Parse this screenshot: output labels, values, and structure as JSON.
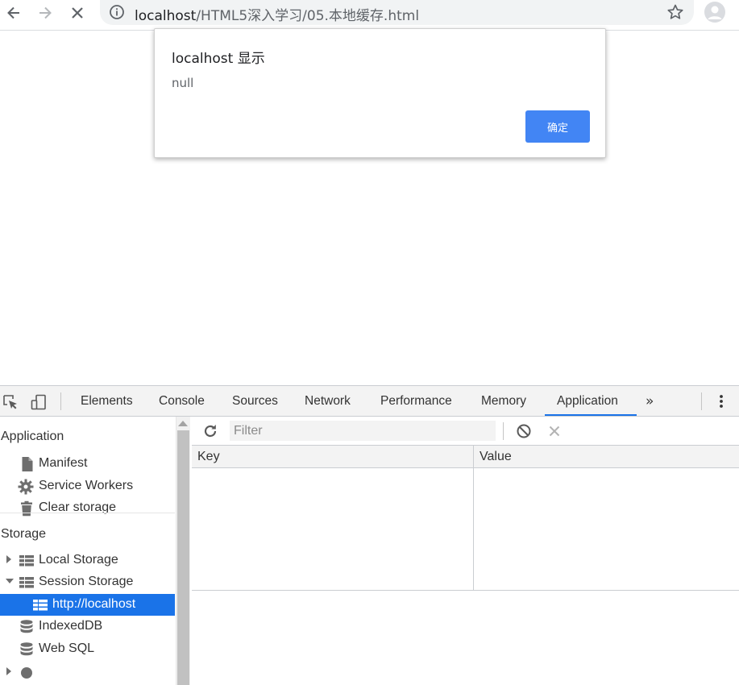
{
  "browser": {
    "url_host": "localhost",
    "url_path": "/HTML5深入学习/05.本地缓存.html",
    "icons": [
      "back-arrow-icon",
      "forward-arrow-icon",
      "stop-icon",
      "info-icon",
      "star-icon",
      "profile-icon"
    ]
  },
  "dialog": {
    "title": "localhost 显示",
    "message": "null",
    "ok_label": "确定",
    "ok_color": "#4285f4"
  },
  "devtools": {
    "tabs": [
      "Elements",
      "Console",
      "Sources",
      "Network",
      "Performance",
      "Memory",
      "Application"
    ],
    "active_tab": "Application",
    "more_label": "»",
    "accent": "#1a73e8",
    "sidebar": {
      "application_title": "Application",
      "application_items": [
        "Manifest",
        "Service Workers",
        "Clear storage"
      ],
      "storage_title": "Storage",
      "storage_items": [
        "Local Storage",
        "Session Storage",
        "http://localhost",
        "IndexedDB",
        "Web SQL"
      ],
      "selected": "http://localhost"
    },
    "toolbar": {
      "filter_placeholder": "Filter"
    },
    "grid": {
      "key_header": "Key",
      "value_header": "Value",
      "rows": []
    }
  }
}
